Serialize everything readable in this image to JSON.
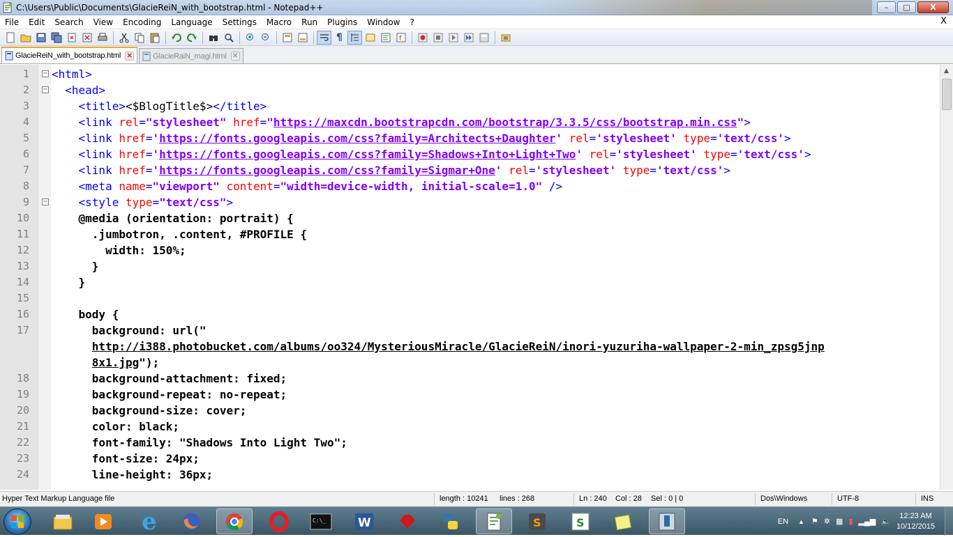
{
  "window": {
    "title": "C:\\Users\\Public\\Documents\\GlacieReiN_with_bootstrap.html - Notepad++",
    "minimize": "–",
    "maximize": "□",
    "close": "X"
  },
  "menu": {
    "items": [
      "File",
      "Edit",
      "Search",
      "View",
      "Encoding",
      "Language",
      "Settings",
      "Macro",
      "Run",
      "Plugins",
      "Window",
      "?"
    ],
    "close_label": "X"
  },
  "tabs": [
    {
      "label": "GlacieReiN_with_bootstrap.html",
      "active": true
    },
    {
      "label": "GlacieRaiN_magi.html",
      "active": false
    }
  ],
  "editor": {
    "lines": [
      {
        "num": "1",
        "fold": "minus",
        "indent": "",
        "html": "<span class='tag'>&lt;html&gt;</span>"
      },
      {
        "num": "2",
        "fold": "minus",
        "indent": "  ",
        "html": "<span class='tag'>&lt;head&gt;</span>"
      },
      {
        "num": "3",
        "fold": "",
        "indent": "    ",
        "html": "<span class='tag'>&lt;title&gt;</span>&lt;$BlogTitle$&gt;<span class='tag'>&lt;/title&gt;</span>"
      },
      {
        "num": "4",
        "fold": "",
        "indent": "    ",
        "html": "<span class='tag'>&lt;link </span><span class='attr'>rel</span><span class='tag'>=</span><span class='str'>\"stylesheet\"</span> <span class='attr'>href</span><span class='tag'>=</span><span class='str'>\"<span class='url'>https://maxcdn.bootstrapcdn.com/bootstrap/3.3.5/css/bootstrap.min.css</span>\"</span><span class='tag'>&gt;</span>"
      },
      {
        "num": "5",
        "fold": "",
        "indent": "    ",
        "html": "<span class='tag'>&lt;link </span><span class='attr'>href</span><span class='tag'>=</span><span class='str'>'<span class='url'>https://fonts.googleapis.com/css?family=Architects+Daughter</span>'</span> <span class='attr'>rel</span><span class='tag'>=</span><span class='str'>'stylesheet'</span> <span class='attr'>type</span><span class='tag'>=</span><span class='str'>'text/css'</span><span class='tag'>&gt;</span>"
      },
      {
        "num": "6",
        "fold": "",
        "indent": "    ",
        "html": "<span class='tag'>&lt;link </span><span class='attr'>href</span><span class='tag'>=</span><span class='str'>'<span class='url'>https://fonts.googleapis.com/css?family=Shadows+Into+Light+Two</span>'</span> <span class='attr'>rel</span><span class='tag'>=</span><span class='str'>'stylesheet'</span> <span class='attr'>type</span><span class='tag'>=</span><span class='str'>'text/css'</span><span class='tag'>&gt;</span>"
      },
      {
        "num": "7",
        "fold": "",
        "indent": "    ",
        "html": "<span class='tag'>&lt;link </span><span class='attr'>href</span><span class='tag'>=</span><span class='str'>'<span class='url'>https://fonts.googleapis.com/css?family=Sigmar+One</span>'</span> <span class='attr'>rel</span><span class='tag'>=</span><span class='str'>'stylesheet'</span> <span class='attr'>type</span><span class='tag'>=</span><span class='str'>'text/css'</span><span class='tag'>&gt;</span>"
      },
      {
        "num": "8",
        "fold": "",
        "indent": "    ",
        "html": "<span class='tag'>&lt;meta </span><span class='attr'>name</span><span class='tag'>=</span><span class='str'>\"viewport\"</span> <span class='attr'>content</span><span class='tag'>=</span><span class='str'>\"width=device-width, initial-scale=1.0\"</span> <span class='tag'>/&gt;</span>"
      },
      {
        "num": "9",
        "fold": "minus",
        "indent": "    ",
        "html": "<span class='tag'>&lt;style </span><span class='attr'>type</span><span class='tag'>=</span><span class='str'>\"text/css\"</span><span class='tag'>&gt;</span>"
      },
      {
        "num": "10",
        "fold": "",
        "indent": "    ",
        "html": "<span class='bold'>@media (orientation: portrait) {</span>"
      },
      {
        "num": "11",
        "fold": "",
        "indent": "      ",
        "html": "<span class='bold'>.jumbotron, .content, #PROFILE {</span>"
      },
      {
        "num": "12",
        "fold": "",
        "indent": "        ",
        "html": "<span class='bold'>width: 150%;</span>"
      },
      {
        "num": "13",
        "fold": "",
        "indent": "      ",
        "html": "<span class='bold'>}</span>"
      },
      {
        "num": "14",
        "fold": "",
        "indent": "    ",
        "html": "<span class='bold'>}</span>"
      },
      {
        "num": "15",
        "fold": "",
        "indent": "",
        "html": ""
      },
      {
        "num": "16",
        "fold": "",
        "indent": "    ",
        "html": "<span class='bold'>body {</span>"
      },
      {
        "num": "17",
        "fold": "",
        "indent": "      ",
        "html": "<span class='bold'>background: url(\"</span>"
      },
      {
        "num": "",
        "fold": "",
        "indent": "      ",
        "html": "<span class='bold' style='text-decoration:underline'>http://i388.photobucket.com/albums/oo324/MysteriousMiracle/GlacieReiN/inori-yuzuriha-wallpaper-2-min_zpsg5jnp</span>"
      },
      {
        "num": "",
        "fold": "",
        "indent": "      ",
        "html": "<span class='bold'><span style='text-decoration:underline'>8x1.jpg</span>\");</span>"
      },
      {
        "num": "18",
        "fold": "",
        "indent": "      ",
        "html": "<span class='bold'>background-attachment: fixed;</span>"
      },
      {
        "num": "19",
        "fold": "",
        "indent": "      ",
        "html": "<span class='bold'>background-repeat: no-repeat;</span>"
      },
      {
        "num": "20",
        "fold": "",
        "indent": "      ",
        "html": "<span class='bold'>background-size: cover;</span>"
      },
      {
        "num": "21",
        "fold": "",
        "indent": "      ",
        "html": "<span class='bold'>color: black;</span>"
      },
      {
        "num": "22",
        "fold": "",
        "indent": "      ",
        "html": "<span class='bold'>font-family: \"Shadows Into Light Two\";</span>"
      },
      {
        "num": "23",
        "fold": "",
        "indent": "      ",
        "html": "<span class='bold'>font-size: 24px;</span>"
      },
      {
        "num": "24",
        "fold": "",
        "indent": "      ",
        "html": "<span class='bold'>line-height: 36px;</span>"
      }
    ]
  },
  "status": {
    "filetype": "Hyper Text Markup Language file",
    "length": "length : 10241",
    "lines": "lines : 268",
    "ln": "Ln : 240",
    "col": "Col : 28",
    "sel": "Sel : 0 | 0",
    "eol": "Dos\\Windows",
    "encoding": "UTF-8",
    "mode": "INS"
  },
  "taskbar": {
    "lang": "EN",
    "time": "12:23 AM",
    "date": "10/12/2015"
  },
  "colors": {
    "tag": "#0000ff",
    "attribute": "#ff0000",
    "string": "#8000ff",
    "active_tab_accent": "#f5a623"
  }
}
